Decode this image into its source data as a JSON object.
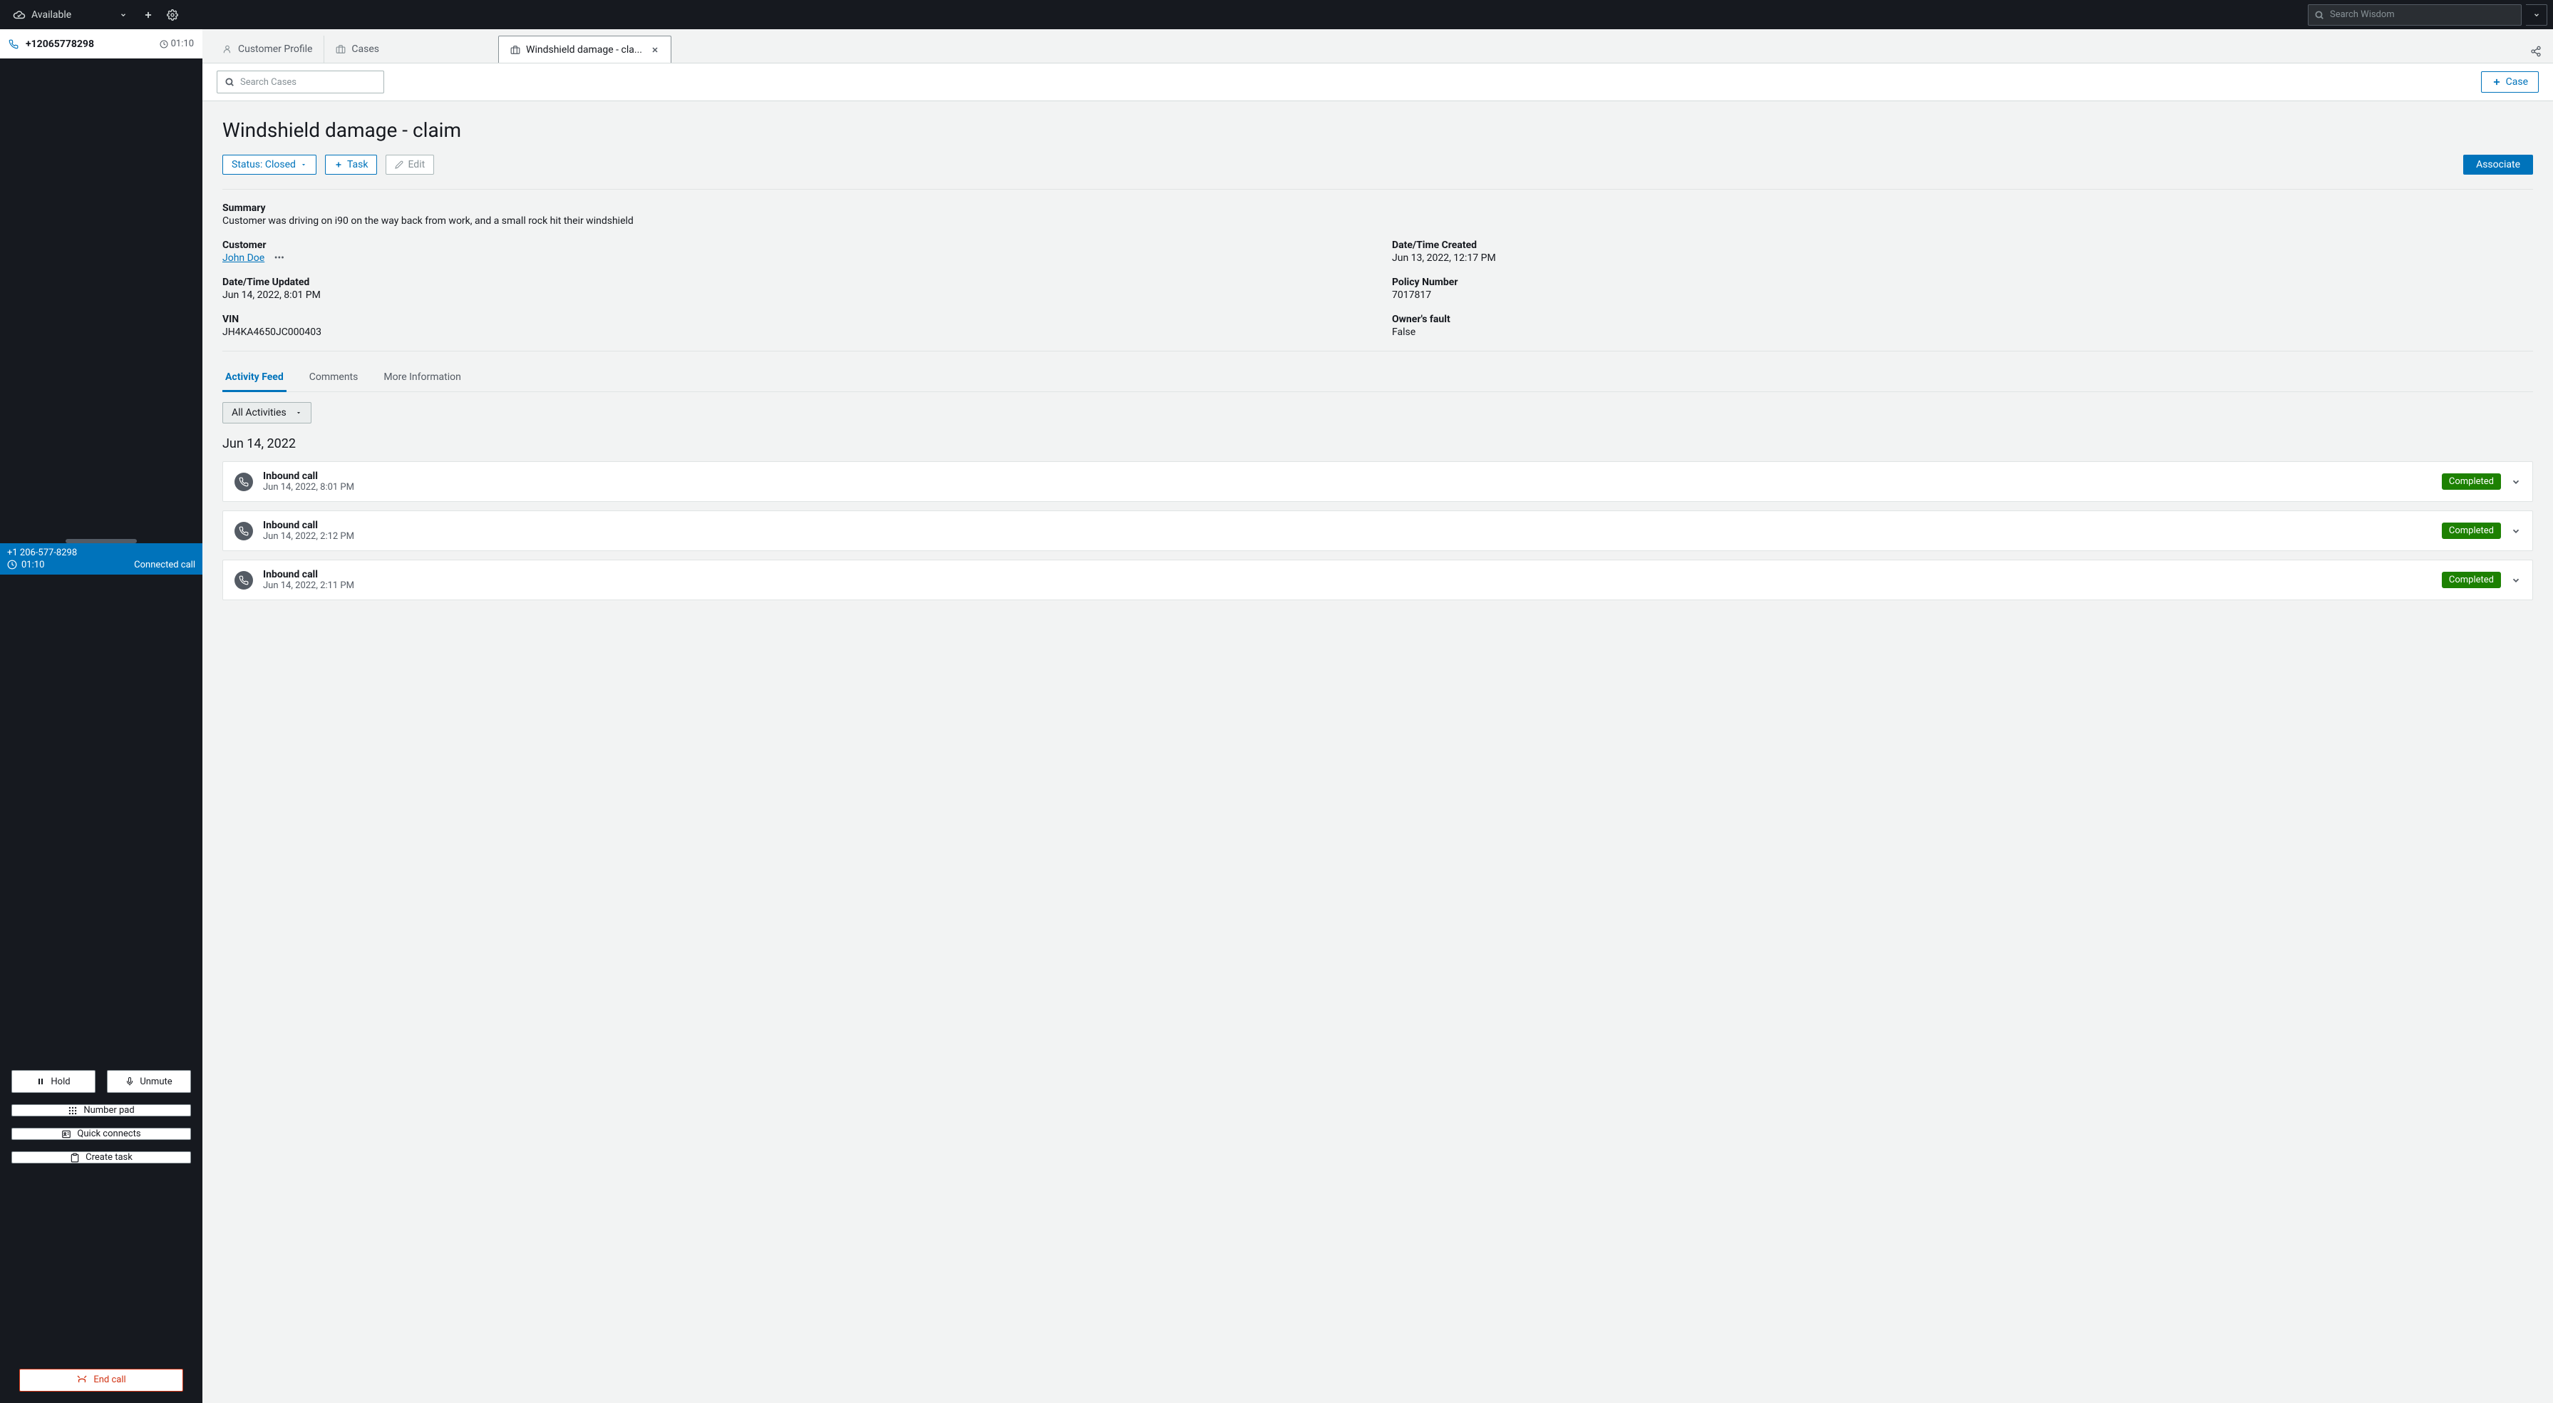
{
  "topbar": {
    "status": "Available",
    "search_placeholder": "Search Wisdom"
  },
  "call_tab": {
    "number": "+12065778298",
    "timer": "01:10"
  },
  "connected": {
    "number": "+1 206-577-8298",
    "timer": "01:10",
    "status": "Connected call"
  },
  "controls": {
    "hold": "Hold",
    "unmute": "Unmute",
    "numpad": "Number pad",
    "quick": "Quick connects",
    "createtask": "Create task",
    "end": "End call"
  },
  "ws_tabs": {
    "profile": "Customer Profile",
    "cases": "Cases",
    "case_detail": "Windshield damage - cla..."
  },
  "case_bar": {
    "search_placeholder": "Search Cases",
    "new_case": "Case"
  },
  "case": {
    "title": "Windshield damage - claim",
    "status_label": "Status: Closed",
    "task_btn": "Task",
    "edit_btn": "Edit",
    "associate_btn": "Associate",
    "summary_label": "Summary",
    "summary_text": "Customer was driving on i90 on the way back from work, and a small rock hit their windshield",
    "customer_label": "Customer",
    "customer_name": "John Doe",
    "created_label": "Date/Time Created",
    "created_val": "Jun 13, 2022, 12:17 PM",
    "updated_label": "Date/Time Updated",
    "updated_val": "Jun 14, 2022, 8:01 PM",
    "policy_label": "Policy Number",
    "policy_val": "7017817",
    "vin_label": "VIN",
    "vin_val": "JH4KA4650JC000403",
    "fault_label": "Owner's fault",
    "fault_val": "False"
  },
  "act_tabs": {
    "feed": "Activity Feed",
    "comments": "Comments",
    "more": "More Information"
  },
  "filter": "All Activities",
  "feed": {
    "date_header": "Jun 14, 2022",
    "items": [
      {
        "title": "Inbound call",
        "time": "Jun 14, 2022, 8:01 PM",
        "status": "Completed"
      },
      {
        "title": "Inbound call",
        "time": "Jun 14, 2022, 2:12 PM",
        "status": "Completed"
      },
      {
        "title": "Inbound call",
        "time": "Jun 14, 2022, 2:11 PM",
        "status": "Completed"
      }
    ]
  }
}
